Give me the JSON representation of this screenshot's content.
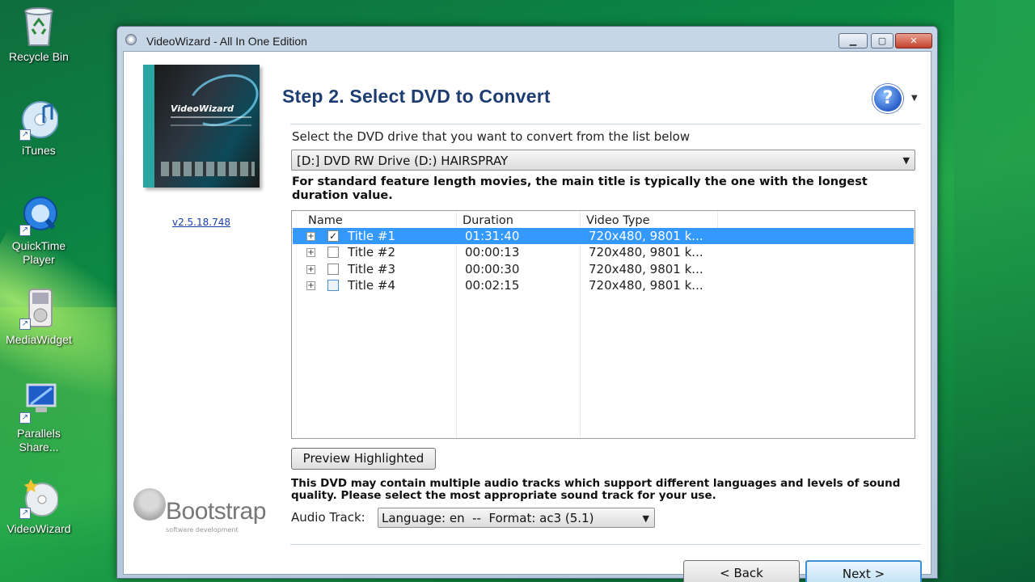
{
  "desktop": {
    "icons": [
      {
        "label": "Recycle Bin",
        "icon": "recycle-bin-icon"
      },
      {
        "label": "iTunes",
        "icon": "itunes-icon"
      },
      {
        "label": "QuickTime Player",
        "icon": "quicktime-icon"
      },
      {
        "label": "MediaWidget",
        "icon": "mediawidget-icon"
      },
      {
        "label": "Parallels Share...",
        "icon": "parallels-icon"
      },
      {
        "label": "VideoWizard",
        "icon": "videowizard-icon"
      }
    ]
  },
  "window": {
    "title": "VideoWizard - All In One Edition",
    "version_link": "v2.5.18.748",
    "logo_word": "Bootstrap",
    "logo_tagline": "software development",
    "box_name": "VideoWizard"
  },
  "step": {
    "title": "Step 2. Select DVD to Convert",
    "help_glyph": "?",
    "drive_label": "Select the DVD drive that you want to convert from the list below",
    "drive_value": "[D:] DVD RW Drive (D:) HAIRSPRAY",
    "note": "For standard feature length movies, the main title is typically the one with the longest duration value."
  },
  "titles_table": {
    "columns": [
      "Name",
      "Duration",
      "Video Type"
    ],
    "rows": [
      {
        "name": "Title #1",
        "duration": "01:31:40",
        "video_type": "720x480, 9801 k...",
        "checked": true,
        "selected": true
      },
      {
        "name": "Title #2",
        "duration": "00:00:13",
        "video_type": "720x480, 9801 k...",
        "checked": false,
        "selected": false
      },
      {
        "name": "Title #3",
        "duration": "00:00:30",
        "video_type": "720x480, 9801 k...",
        "checked": false,
        "selected": false
      },
      {
        "name": "Title #4",
        "duration": "00:02:15",
        "video_type": "720x480, 9801 k...",
        "checked": false,
        "selected": false
      }
    ]
  },
  "preview_button": "Preview Highlighted",
  "audio": {
    "note": "This DVD may contain multiple audio tracks which support different languages and levels of sound quality. Please select the most appropriate sound track for your use.",
    "label": "Audio Track:",
    "value": "Language: en  --  Format: ac3 (5.1)"
  },
  "nav": {
    "back": "< Back",
    "next": "Next >"
  },
  "colors": {
    "accent": "#3399ff",
    "title_text": "#1d3d72",
    "desktop": "#0b8a44"
  }
}
